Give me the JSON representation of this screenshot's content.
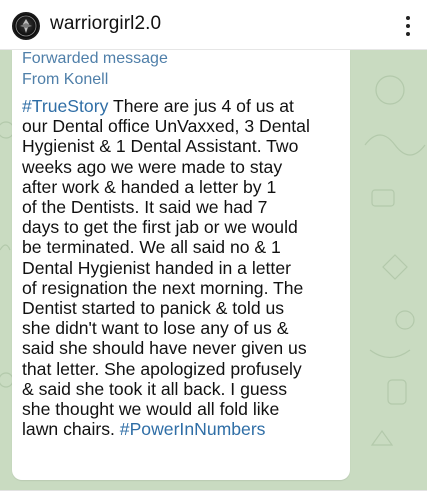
{
  "post": {
    "username": "warriorgirl2.0",
    "avatar_icon": "profile-avatar-icon",
    "more_icon": "more-vertical-icon"
  },
  "message": {
    "forwarded_label": "Forwarded message",
    "from_label": "From Konell",
    "hashtag_start": "#TrueStory",
    "hashtag_end": "#PowerInNumbers",
    "lines": [
      " There are jus 4 of us at",
      "our Dental office UnVaxxed, 3 Dental",
      "Hygienist & 1 Dental Assistant.  Two",
      "weeks ago we were made to stay",
      "after work & handed a letter by 1",
      "of the Dentists.  It said we had 7",
      "days to get the first jab or we would",
      "be terminated.  We all said no & 1",
      "Dental Hygienist handed in a letter",
      "of resignation the next morning.  The",
      "Dentist started to panick & told us",
      "she didn't want to lose any of us &",
      "said she should have never given us",
      "that letter.  She apologized profusely",
      "& said she took it all back. I guess",
      "she thought we would all fold like",
      "lawn chairs. "
    ]
  },
  "colors": {
    "chat_background": "#c9dbc1",
    "link_blue": "#2f6ea6",
    "forward_blue": "#4f7fa9"
  }
}
